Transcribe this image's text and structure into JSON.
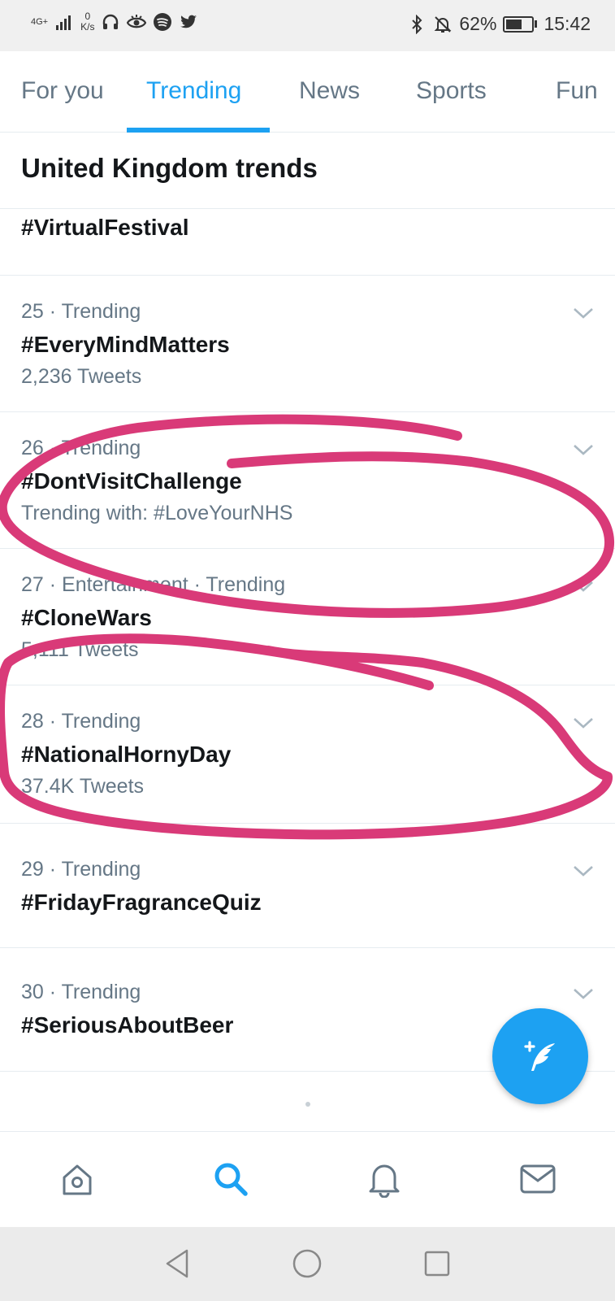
{
  "status_bar": {
    "network": "4G+",
    "speed_value": "0",
    "speed_unit": "K/s",
    "battery": "62%",
    "battery_level": 0.62,
    "time": "15:42"
  },
  "tabs": [
    {
      "label": "For you",
      "active": false
    },
    {
      "label": "Trending",
      "active": true
    },
    {
      "label": "News",
      "active": false
    },
    {
      "label": "Sports",
      "active": false
    },
    {
      "label": "Fun",
      "active": false
    }
  ],
  "section_title": "United Kingdom trends",
  "trends": [
    {
      "meta": "",
      "name": "#VirtualFestival",
      "sub": ""
    },
    {
      "meta": "25 · Trending",
      "name": "#EveryMindMatters",
      "sub": "2,236 Tweets"
    },
    {
      "meta": "26 · Trending",
      "name": "#DontVisitChallenge",
      "sub": "Trending with: #LoveYourNHS"
    },
    {
      "meta": "27 · Entertainment · Trending",
      "name": "#CloneWars",
      "sub": "5,111 Tweets"
    },
    {
      "meta": "28 · Trending",
      "name": "#NationalHornyDay",
      "sub": "37.4K Tweets"
    },
    {
      "meta": "29 · Trending",
      "name": "#FridayFragranceQuiz",
      "sub": ""
    },
    {
      "meta": "30 · Trending",
      "name": "#SeriousAboutBeer",
      "sub": ""
    }
  ],
  "colors": {
    "accent": "#1da1f2",
    "annotation": "#d93a78",
    "text_primary": "#14171a",
    "text_secondary": "#657786"
  },
  "icons": {
    "bottom_nav": [
      "home-icon",
      "search-icon",
      "bell-icon",
      "mail-icon"
    ],
    "fab": "compose-tweet-icon",
    "system_nav": [
      "back-icon",
      "home-circle-icon",
      "recents-icon"
    ]
  }
}
